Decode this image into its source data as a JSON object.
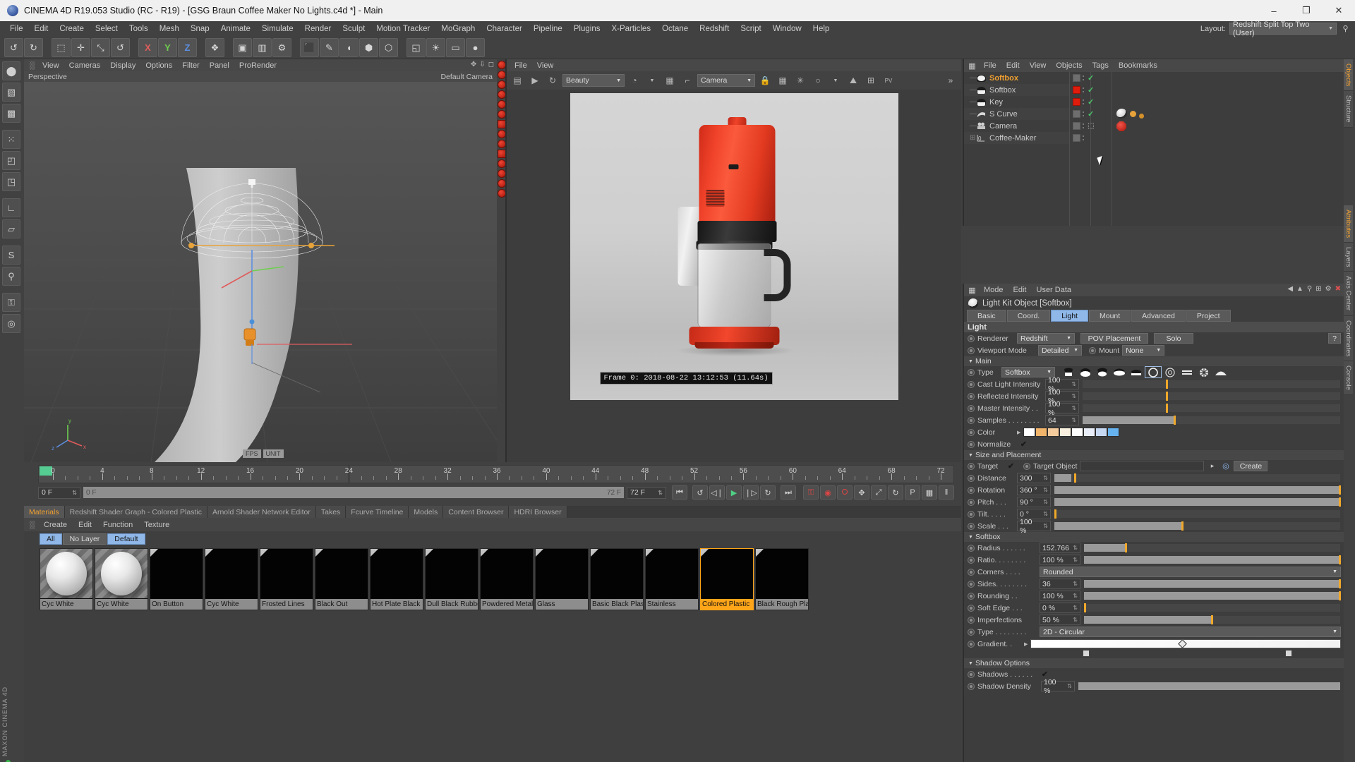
{
  "window": {
    "title": "CINEMA 4D R19.053 Studio (RC - R19) - [GSG Braun Coffee Maker No Lights.c4d *] - Main",
    "minimize": "–",
    "maximize": "❐",
    "close": "✕"
  },
  "menubar": {
    "items": [
      "File",
      "Edit",
      "Create",
      "Select",
      "Tools",
      "Mesh",
      "Snap",
      "Animate",
      "Simulate",
      "Render",
      "Sculpt",
      "Motion Tracker",
      "MoGraph",
      "Character",
      "Pipeline",
      "Plugins",
      "X-Particles",
      "Octane",
      "Redshift",
      "Script",
      "Window",
      "Help"
    ],
    "layout_label": "Layout:",
    "layout_value": "Redshift Split Top Two (User)",
    "search_icon": "⚲"
  },
  "toolbar": {
    "buttons": [
      {
        "name": "undo-button",
        "glyph": "↺"
      },
      {
        "name": "redo-button",
        "glyph": "↻"
      },
      {
        "name": "live-select-button",
        "glyph": "⬚"
      },
      {
        "name": "move-button",
        "glyph": "✛"
      },
      {
        "name": "scale-button",
        "glyph": "⤡"
      },
      {
        "name": "rotate-button",
        "glyph": "↺"
      },
      {
        "name": "x-axis-button",
        "glyph": "X"
      },
      {
        "name": "y-axis-button",
        "glyph": "Y"
      },
      {
        "name": "z-axis-button",
        "glyph": "Z"
      },
      {
        "name": "world-coord-button",
        "glyph": "❖"
      },
      {
        "name": "render-view-button",
        "glyph": "▣"
      },
      {
        "name": "render-region-button",
        "glyph": "▥"
      },
      {
        "name": "render-settings-button",
        "glyph": "⚙"
      },
      {
        "name": "cube-primitive-button",
        "glyph": "⬛"
      },
      {
        "name": "spline-pen-button",
        "glyph": "✎"
      },
      {
        "name": "nurbs-button",
        "glyph": "◖"
      },
      {
        "name": "array-button",
        "glyph": "⬢"
      },
      {
        "name": "deformer-button",
        "glyph": "⬡"
      },
      {
        "name": "camera-button",
        "glyph": "◱"
      },
      {
        "name": "light-button",
        "glyph": "☀"
      },
      {
        "name": "floor-button",
        "glyph": "▭"
      },
      {
        "name": "material-sphere-button",
        "glyph": "●"
      }
    ]
  },
  "left_tools": {
    "buttons": [
      {
        "name": "model-mode-icon",
        "glyph": "⬤"
      },
      {
        "name": "object-mode-icon",
        "glyph": "▧"
      },
      {
        "name": "texture-mode-icon",
        "glyph": "▩"
      },
      {
        "name": "points-mode-icon",
        "glyph": "⁙"
      },
      {
        "name": "edges-mode-icon",
        "glyph": "◰"
      },
      {
        "name": "polygons-mode-icon",
        "glyph": "◳"
      },
      {
        "name": "axis-lock-icon",
        "glyph": "∟"
      },
      {
        "name": "workplane-icon",
        "glyph": "▱"
      },
      {
        "name": "snap-icon",
        "glyph": "S"
      },
      {
        "name": "magnet-icon",
        "glyph": "⚲"
      },
      {
        "name": "lock-icon",
        "glyph": "⚿"
      },
      {
        "name": "viewport-solo-icon",
        "glyph": "◎"
      }
    ],
    "brand": "MAXON CINEMA 4D"
  },
  "viewport": {
    "menu": [
      "View",
      "Cameras",
      "Display",
      "Options",
      "Filter",
      "Panel",
      "ProRender"
    ],
    "label_left": "Perspective",
    "label_right": "Default Camera",
    "axis_x": "x",
    "axis_y": "y",
    "axis_z": "z"
  },
  "picture_viewer": {
    "menu": [
      "File",
      "View"
    ],
    "pass_dropdown": "Beauty",
    "camera_dropdown": "Camera",
    "frame_info": "Frame 0: 2018-08-22 13:12:53 (11.64s)",
    "buttons": [
      {
        "name": "open-file-icon",
        "glyph": "▤"
      },
      {
        "name": "play-render-icon",
        "glyph": "▶"
      },
      {
        "name": "refresh-icon",
        "glyph": "↻"
      },
      {
        "name": "histogram-icon",
        "glyph": "◔"
      },
      {
        "name": "grid-icon",
        "glyph": "▦"
      },
      {
        "name": "crop-icon",
        "glyph": "⌐"
      },
      {
        "name": "lock-icon",
        "glyph": "⚿"
      },
      {
        "name": "layers-icon",
        "glyph": "☷"
      },
      {
        "name": "snowflake-icon",
        "glyph": "✳"
      },
      {
        "name": "circle-icon",
        "glyph": "○"
      },
      {
        "name": "image-icon",
        "glyph": "⛰"
      },
      {
        "name": "add-image-icon",
        "glyph": "⊞"
      },
      {
        "name": "pv-icon",
        "glyph": "PV"
      },
      {
        "name": "overflow-icon",
        "glyph": "»"
      }
    ]
  },
  "timeline": {
    "major_labels": [
      0,
      4,
      8,
      12,
      16,
      20,
      24,
      28,
      32,
      36,
      40,
      44,
      48,
      52,
      56,
      60,
      64,
      68,
      72
    ],
    "range_start": 0,
    "range_end": 72,
    "current_frame_field": "0 F",
    "bar_left_label": "0 F",
    "bar_right_label": "72 F",
    "end_frame_field": "72 F",
    "transport": [
      {
        "name": "goto-start-button",
        "glyph": "⏮"
      },
      {
        "name": "play-reverse-loop-button",
        "glyph": "↺"
      },
      {
        "name": "step-back-button",
        "glyph": "◁❘"
      },
      {
        "name": "play-button",
        "glyph": "▶"
      },
      {
        "name": "step-forward-button",
        "glyph": "❘▷"
      },
      {
        "name": "loop-button",
        "glyph": "↻"
      },
      {
        "name": "goto-end-button",
        "glyph": "⏭"
      }
    ],
    "keyframe_tools": [
      {
        "name": "record-keyframe-button",
        "glyph": "⚿"
      },
      {
        "name": "autokey-button",
        "glyph": "◉"
      },
      {
        "name": "keyframe-selection-button",
        "glyph": "⭘"
      },
      {
        "name": "position-key-button",
        "glyph": "✥"
      },
      {
        "name": "scale-key-button",
        "glyph": "⤢"
      },
      {
        "name": "rotation-key-button",
        "glyph": "↻"
      },
      {
        "name": "param-key-button",
        "glyph": "P"
      },
      {
        "name": "pla-key-button",
        "glyph": "▦"
      },
      {
        "name": "timeline-toggle-button",
        "glyph": "‖"
      }
    ]
  },
  "material_manager": {
    "tabs": [
      {
        "label": "Materials",
        "active": true
      },
      {
        "label": "Redshift Shader Graph - Colored Plastic",
        "active": false
      },
      {
        "label": "Arnold Shader Network Editor",
        "active": false
      },
      {
        "label": "Takes",
        "active": false
      },
      {
        "label": "Fcurve Timeline",
        "active": false
      },
      {
        "label": "Models",
        "active": false
      },
      {
        "label": "Content Browser",
        "active": false
      },
      {
        "label": "HDRI Browser",
        "active": false
      }
    ],
    "menu": [
      "Create",
      "Edit",
      "Function",
      "Texture"
    ],
    "filters": [
      {
        "label": "All",
        "active": true
      },
      {
        "label": "No Layer",
        "active": false
      },
      {
        "label": "Default",
        "active": true
      }
    ],
    "materials": [
      {
        "name": "Cyc White",
        "thumb": "sphere",
        "selected": false
      },
      {
        "name": "Cyc White",
        "thumb": "sphere",
        "selected": false
      },
      {
        "name": "On Button",
        "thumb": "black",
        "selected": false
      },
      {
        "name": "Cyc White",
        "thumb": "black",
        "selected": false
      },
      {
        "name": "Frosted Lines",
        "thumb": "black",
        "selected": false
      },
      {
        "name": "Black Out",
        "thumb": "black",
        "selected": false
      },
      {
        "name": "Hot Plate Black",
        "thumb": "black",
        "selected": false
      },
      {
        "name": "Dull Black Rubbe",
        "thumb": "black",
        "selected": false
      },
      {
        "name": "Powdered Metal",
        "thumb": "black",
        "selected": false
      },
      {
        "name": "Glass",
        "thumb": "black",
        "selected": false
      },
      {
        "name": "Basic Black Plasti",
        "thumb": "black",
        "selected": false
      },
      {
        "name": "Stainless",
        "thumb": "black",
        "selected": false
      },
      {
        "name": "Colored Plastic",
        "thumb": "black",
        "selected": true
      },
      {
        "name": "Black Rough Plas",
        "thumb": "black",
        "selected": false
      }
    ]
  },
  "object_manager": {
    "menu": [
      "File",
      "Edit",
      "View",
      "Objects",
      "Tags",
      "Bookmarks"
    ],
    "rows": [
      {
        "label": "Softbox",
        "icon": "softbox-dome-icon",
        "selected": true,
        "tag_color": "grey",
        "visible": true
      },
      {
        "label": "Softbox",
        "icon": "softbox-icon",
        "selected": false,
        "tag_color": "red",
        "visible": true
      },
      {
        "label": "Key",
        "icon": "softbox-icon",
        "selected": false,
        "tag_color": "red",
        "visible": true
      },
      {
        "label": "S Curve",
        "icon": "spline-icon",
        "selected": false,
        "tag_color": "grey",
        "visible": true
      },
      {
        "label": "Camera",
        "icon": "camera-icon",
        "selected": false,
        "tag_color": "grey",
        "visible": false
      },
      {
        "label": "Coffee-Maker",
        "icon": "null-object-icon",
        "selected": false,
        "tag_color": "grey",
        "visible": false
      }
    ]
  },
  "attribute_manager": {
    "menu": [
      "Mode",
      "Edit",
      "User Data"
    ],
    "header_icons": [
      "◀",
      "▲",
      "⚲",
      "⊞",
      "⚙",
      "✖"
    ],
    "object_title": "Light Kit Object [Softbox]",
    "tabs": [
      {
        "label": "Basic",
        "active": false
      },
      {
        "label": "Coord.",
        "active": false
      },
      {
        "label": "Light",
        "active": true
      },
      {
        "label": "Mount",
        "active": false
      },
      {
        "label": "Advanced",
        "active": false
      },
      {
        "label": "Project",
        "active": false
      }
    ],
    "section_light": "Light",
    "renderer_label": "Renderer",
    "renderer_value": "Redshift",
    "pov_button": "POV Placement",
    "solo_button": "Solo",
    "help_button": "?",
    "viewport_mode_label": "Viewport Mode",
    "viewport_mode_value": "Detailed",
    "mount_label": "Mount",
    "mount_value": "None",
    "group_main": "Main",
    "type_label": "Type",
    "type_value": "Softbox",
    "params_main": [
      {
        "label": "Cast Light Intensity",
        "value": "100 %",
        "fill": 0.0,
        "knob": 0.33
      },
      {
        "label": "Reflected Intensity",
        "value": "100 %",
        "fill": 0.0,
        "knob": 0.33
      },
      {
        "label": "Master Intensity . .",
        "value": "100 %",
        "fill": 0.0,
        "knob": 0.33
      },
      {
        "label": "Samples . . . . . . . .",
        "value": "64",
        "fill": 0.36,
        "knob": 0.36
      }
    ],
    "color_label": "Color",
    "color_swatches": [
      "#ffffff",
      "#f0b46a",
      "#f3cb9c",
      "#faf0df",
      "#fdfdfd",
      "#e8edf7",
      "#c7d8f2",
      "#66b3f0"
    ],
    "normalize_label": "Normalize",
    "normalize_checked": true,
    "group_size": "Size and Placement",
    "target_label": "Target",
    "target_checked": true,
    "target_object_label": "Target Object",
    "target_object_value": "",
    "create_button": "Create",
    "params_size": [
      {
        "label": "Distance",
        "value": "300",
        "fill": 0.06,
        "knob": 0.075
      },
      {
        "label": "Rotation",
        "value": "360 °",
        "fill": 1.0,
        "knob": 1.0
      },
      {
        "label": "Pitch . . .",
        "value": "90 °",
        "fill": 1.0,
        "knob": 1.0
      },
      {
        "label": "Tilt. . . . .",
        "value": "0 °",
        "fill": 0.0,
        "knob": 0.005
      },
      {
        "label": "Scale . . .",
        "value": "100 %",
        "fill": 0.45,
        "knob": 0.45
      }
    ],
    "group_softbox": "Softbox",
    "params_softbox": [
      {
        "label": "Radius . . . . . .",
        "value": "152.766",
        "fill": 0.16,
        "knob": 0.165
      },
      {
        "label": "Ratio. . . . . . . .",
        "value": "100 %",
        "fill": 1.0,
        "knob": 1.0
      }
    ],
    "corners_label": "Corners . . . .",
    "corners_value": "Rounded",
    "params_softbox2": [
      {
        "label": "Sides. . . . . . . .",
        "value": "36",
        "fill": 1.0,
        "knob": 1.0
      },
      {
        "label": "Rounding . .",
        "value": "100 %",
        "fill": 1.0,
        "knob": 1.0
      },
      {
        "label": "Soft Edge . . .",
        "value": "0 %",
        "fill": 0.0,
        "knob": 0.005
      },
      {
        "label": "Imperfections",
        "value": "50 %",
        "fill": 0.5,
        "knob": 0.5
      }
    ],
    "type2_label": "Type . . . . . . . .",
    "type2_value": "2D - Circular",
    "gradient_label": "Gradient. .",
    "group_shadow": "Shadow Options",
    "shadows_label": "Shadows . . . . . .",
    "shadows_checked": true,
    "shadow_density_label": "Shadow Density",
    "shadow_density_value": "100 %"
  },
  "right_tabs_top": [
    {
      "label": "Objects",
      "active": true
    },
    {
      "label": "Structure",
      "active": false
    }
  ],
  "right_tabs_bottom": [
    {
      "label": "Attributes",
      "active": true
    },
    {
      "label": "Layers",
      "active": false
    },
    {
      "label": "Axis Center",
      "active": false
    },
    {
      "label": "Coordinates",
      "active": false
    },
    {
      "label": "Console",
      "active": false
    }
  ],
  "colors": {
    "accent_orange": "#f0a030",
    "accent_blue": "#8fb7e8",
    "slider_knob": "#f0a82a",
    "red_tag": "#e01d0d",
    "green_check": "#49c469"
  }
}
